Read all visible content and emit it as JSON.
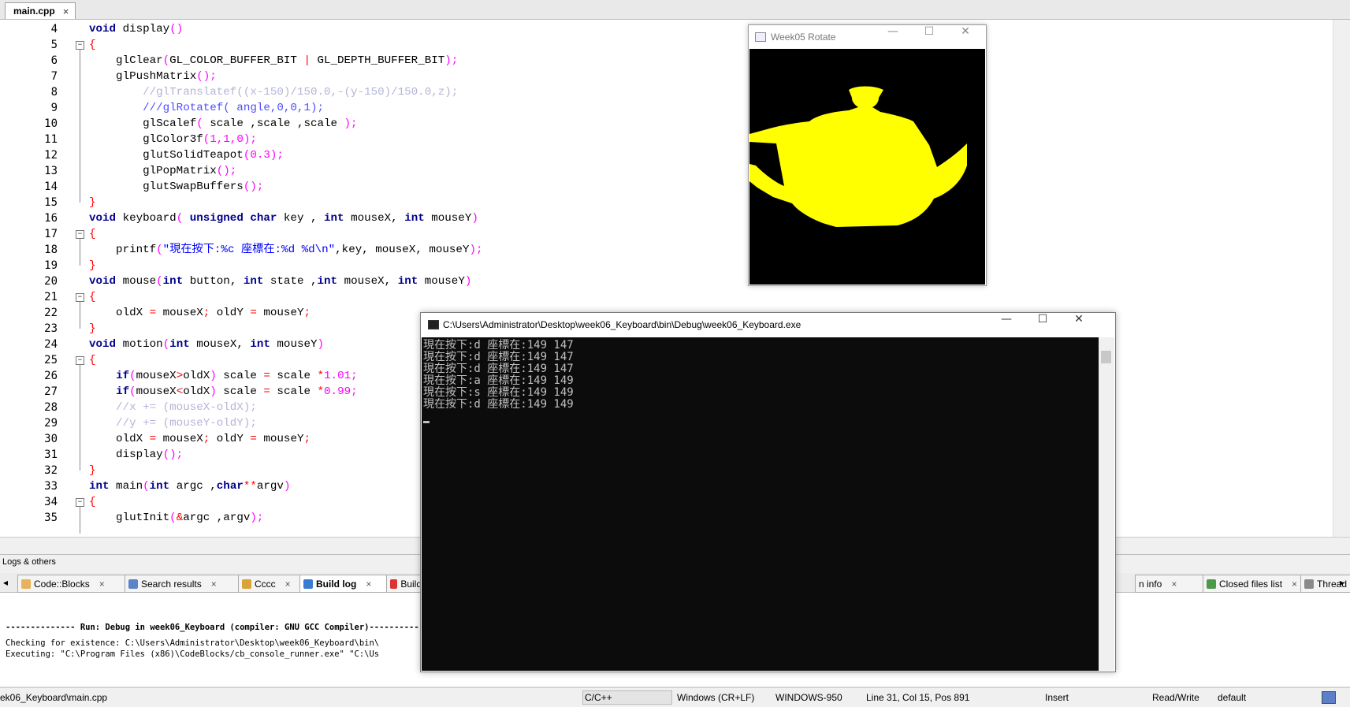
{
  "editor_tab": {
    "label": "main.cpp",
    "close": "×"
  },
  "line_numbers": [
    "4",
    "5",
    "6",
    "7",
    "8",
    "9",
    "10",
    "11",
    "12",
    "13",
    "14",
    "15",
    "16",
    "17",
    "18",
    "19",
    "20",
    "21",
    "22",
    "23",
    "24",
    "25",
    "26",
    "27",
    "28",
    "29",
    "30",
    "31",
    "32",
    "33",
    "34",
    "35"
  ],
  "code_lines": [
    [
      [
        "kw",
        "void"
      ],
      [
        "n",
        " display"
      ],
      [
        "pp",
        "()"
      ]
    ],
    [
      [
        "op",
        "{"
      ]
    ],
    [
      [
        "n",
        "    glClear"
      ],
      [
        "pp",
        "("
      ],
      [
        "n",
        "GL_COLOR_BUFFER_BIT "
      ],
      [
        "op",
        "|"
      ],
      [
        "n",
        " GL_DEPTH_BUFFER_BIT"
      ],
      [
        "pp",
        ");"
      ]
    ],
    [
      [
        "n",
        "    glPushMatrix"
      ],
      [
        "pp",
        "();"
      ]
    ],
    [
      [
        "cm",
        "        //glTranslatef((x-150)/150.0,-(y-150)/150.0,z);"
      ]
    ],
    [
      [
        "cmd",
        "        ///glRotatef( angle,0,0,1);"
      ]
    ],
    [
      [
        "n",
        "        glScalef"
      ],
      [
        "pp",
        "("
      ],
      [
        "n",
        " scale ,scale ,scale "
      ],
      [
        "pp",
        ");"
      ]
    ],
    [
      [
        "n",
        "        glColor3f"
      ],
      [
        "pp",
        "(1,1,0);"
      ]
    ],
    [
      [
        "n",
        "        glutSolidTeapot"
      ],
      [
        "pp",
        "(0.3);"
      ]
    ],
    [
      [
        "n",
        "        glPopMatrix"
      ],
      [
        "pp",
        "();"
      ]
    ],
    [
      [
        "n",
        "        glutSwapBuffers"
      ],
      [
        "pp",
        "();"
      ]
    ],
    [
      [
        "op",
        "}"
      ]
    ],
    [
      [
        "kw",
        "void"
      ],
      [
        "n",
        " keyboard"
      ],
      [
        "pp",
        "("
      ],
      [
        "n",
        " "
      ],
      [
        "kw",
        "unsigned char"
      ],
      [
        "n",
        " key , "
      ],
      [
        "kw",
        "int"
      ],
      [
        "n",
        " mouseX, "
      ],
      [
        "kw",
        "int"
      ],
      [
        "n",
        " mouseY"
      ],
      [
        "pp",
        ")"
      ]
    ],
    [
      [
        "op",
        "{"
      ]
    ],
    [
      [
        "n",
        "    printf"
      ],
      [
        "pp",
        "("
      ],
      [
        "st",
        "\"現在按下:%c 座標在:%d %d\\n\""
      ],
      [
        "n",
        ",key, mouseX, mouseY"
      ],
      [
        "pp",
        ");"
      ]
    ],
    [
      [
        "op",
        "}"
      ]
    ],
    [
      [
        "kw",
        "void"
      ],
      [
        "n",
        " mouse"
      ],
      [
        "pp",
        "("
      ],
      [
        "kw",
        "int"
      ],
      [
        "n",
        " button, "
      ],
      [
        "kw",
        "int"
      ],
      [
        "n",
        " state ,"
      ],
      [
        "kw",
        "int"
      ],
      [
        "n",
        " mouseX, "
      ],
      [
        "kw",
        "int"
      ],
      [
        "n",
        " mouseY"
      ],
      [
        "pp",
        ")"
      ]
    ],
    [
      [
        "op",
        "{"
      ]
    ],
    [
      [
        "n",
        "    oldX "
      ],
      [
        "op",
        "="
      ],
      [
        "n",
        " mouseX"
      ],
      [
        "op",
        ";"
      ],
      [
        "n",
        " oldY "
      ],
      [
        "op",
        "="
      ],
      [
        "n",
        " mouseY"
      ],
      [
        "op",
        ";"
      ]
    ],
    [
      [
        "op",
        "}"
      ]
    ],
    [
      [
        "kw",
        "void"
      ],
      [
        "n",
        " motion"
      ],
      [
        "pp",
        "("
      ],
      [
        "kw",
        "int"
      ],
      [
        "n",
        " mouseX, "
      ],
      [
        "kw",
        "int"
      ],
      [
        "n",
        " mouseY"
      ],
      [
        "pp",
        ")"
      ]
    ],
    [
      [
        "op",
        "{"
      ]
    ],
    [
      [
        "n",
        "    "
      ],
      [
        "kw",
        "if"
      ],
      [
        "pp",
        "("
      ],
      [
        "n",
        "mouseX"
      ],
      [
        "op",
        ">"
      ],
      [
        "n",
        "oldX"
      ],
      [
        "pp",
        ")"
      ],
      [
        "n",
        " scale "
      ],
      [
        "op",
        "="
      ],
      [
        "n",
        " scale "
      ],
      [
        "op",
        "*"
      ],
      [
        "pp",
        "1.01;"
      ]
    ],
    [
      [
        "n",
        "    "
      ],
      [
        "kw",
        "if"
      ],
      [
        "pp",
        "("
      ],
      [
        "n",
        "mouseX"
      ],
      [
        "op",
        "<"
      ],
      [
        "n",
        "oldX"
      ],
      [
        "pp",
        ")"
      ],
      [
        "n",
        " scale "
      ],
      [
        "op",
        "="
      ],
      [
        "n",
        " scale "
      ],
      [
        "op",
        "*"
      ],
      [
        "pp",
        "0.99;"
      ]
    ],
    [
      [
        "cm",
        "    //x += (mouseX-oldX);"
      ]
    ],
    [
      [
        "cm",
        "    //y += (mouseY-oldY);"
      ]
    ],
    [
      [
        "n",
        "    oldX "
      ],
      [
        "op",
        "="
      ],
      [
        "n",
        " mouseX"
      ],
      [
        "op",
        ";"
      ],
      [
        "n",
        " oldY "
      ],
      [
        "op",
        "="
      ],
      [
        "n",
        " mouseY"
      ],
      [
        "op",
        ";"
      ]
    ],
    [
      [
        "n",
        "    display"
      ],
      [
        "pp",
        "();"
      ]
    ],
    [
      [
        "op",
        "}"
      ]
    ],
    [
      [
        "kw",
        "int"
      ],
      [
        "n",
        " main"
      ],
      [
        "pp",
        "("
      ],
      [
        "kw",
        "int"
      ],
      [
        "n",
        " argc ,"
      ],
      [
        "kw",
        "char"
      ],
      [
        "op",
        "**"
      ],
      [
        "n",
        "argv"
      ],
      [
        "pp",
        ")"
      ]
    ],
    [
      [
        "op",
        "{"
      ]
    ],
    [
      [
        "n",
        "    glutInit"
      ],
      [
        "pp",
        "("
      ],
      [
        "op",
        "&"
      ],
      [
        "n",
        "argc ,argv"
      ],
      [
        "pp",
        ");"
      ]
    ]
  ],
  "gl_window": {
    "title": "Week05 Rotate",
    "teapot_color": "#ffff00",
    "background": "#000000"
  },
  "console": {
    "title": "C:\\Users\\Administrator\\Desktop\\week06_Keyboard\\bin\\Debug\\week06_Keyboard.exe",
    "lines": [
      "現在按下:d 座標在:149 147",
      "現在按下:d 座標在:149 147",
      "現在按下:d 座標在:149 147",
      "現在按下:a 座標在:149 149",
      "現在按下:s 座標在:149 149",
      "現在按下:d 座標在:149 149"
    ]
  },
  "logs": {
    "title": "Logs & others",
    "tabs": [
      {
        "label": "Code::Blocks",
        "icon": "codeblocks-icon"
      },
      {
        "label": "Search results",
        "icon": "search-icon"
      },
      {
        "label": "Cccc",
        "icon": "pencil-icon"
      },
      {
        "label": "Build log",
        "icon": "gear-icon"
      },
      {
        "label": "Build",
        "icon": "build-icon"
      },
      {
        "label": "n info",
        "icon": ""
      },
      {
        "label": "Closed files list",
        "icon": "closed-files-icon"
      },
      {
        "label": "Thread",
        "icon": "thread-icon"
      }
    ],
    "lines": [
      "-------------- Run: Debug in week06_Keyboard (compiler: GNU GCC Compiler)---------------",
      "Checking for existence: C:\\Users\\Administrator\\Desktop\\week06_Keyboard\\bin\\",
      "Executing: \"C:\\Program Files (x86)\\CodeBlocks/cb_console_runner.exe\" \"C:\\Us"
    ]
  },
  "status": {
    "file": "ek06_Keyboard\\main.cpp",
    "lang": "C/C++",
    "eol": "Windows (CR+LF)",
    "encoding": "WINDOWS-950",
    "position": "Line 31, Col 15, Pos 891",
    "mode": "Insert",
    "access": "Read/Write",
    "profile": "default"
  }
}
